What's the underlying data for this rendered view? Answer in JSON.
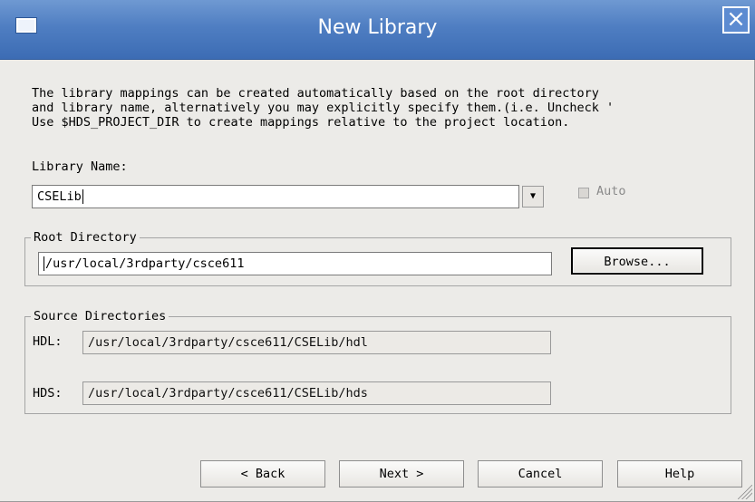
{
  "window": {
    "title": "New Library"
  },
  "intro": {
    "line1": "The library mappings can be created automatically based on the root directory",
    "line2": "and library name, alternatively you may explicitly specify them.(i.e. Uncheck '",
    "line3": "Use $HDS_PROJECT_DIR to create mappings relative to the project location."
  },
  "library": {
    "label": "Library Name:",
    "value": "CSELib",
    "auto_label": "Auto",
    "dropdown_glyph": "▼"
  },
  "root": {
    "legend": "Root Directory",
    "value": "/usr/local/3rdparty/csce611",
    "browse_label": "Browse..."
  },
  "sources": {
    "legend": "Source Directories",
    "hdl_label": "HDL:",
    "hdl_value": "/usr/local/3rdparty/csce611/CSELib/hdl",
    "hds_label": "HDS:",
    "hds_value": "/usr/local/3rdparty/csce611/CSELib/hds"
  },
  "buttons": {
    "back": "< Back",
    "next": "Next >",
    "cancel": "Cancel",
    "help": "Help"
  }
}
